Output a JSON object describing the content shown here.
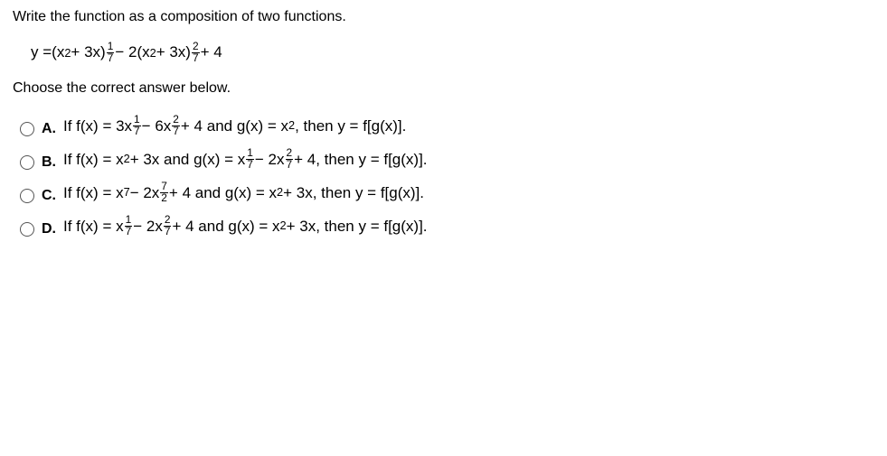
{
  "question_text": "Write the function as a composition of two functions.",
  "instruction": "Choose the correct answer below.",
  "equation": {
    "lhs": "y = ",
    "part1_base": "(x",
    "part1_sup": "2",
    "part1_cont": " + 3x)",
    "frac1_num": "1",
    "frac1_den": "7",
    "minus2": " − 2",
    "part2_base": "(x",
    "part2_sup": "2",
    "part2_cont": " + 3x)",
    "frac2_num": "2",
    "frac2_den": "7",
    "plus4": " + 4"
  },
  "choices": {
    "A": {
      "label": "A.",
      "p": {
        "t1": "If f(x) = 3x",
        "f1n": "1",
        "f1d": "7",
        "t2": " − 6x",
        "f2n": "2",
        "f2d": "7",
        "t3": " + 4 and g(x) = x",
        "s1": "2",
        "t4": ", then y = f[g(x)]."
      }
    },
    "B": {
      "label": "B.",
      "p": {
        "t1": "If f(x) = x",
        "s1": "2",
        "t2": " + 3x and g(x) = x",
        "f1n": "1",
        "f1d": "7",
        "t3": " − 2x",
        "f2n": "2",
        "f2d": "7",
        "t4": " + 4, then y = f[g(x)]."
      }
    },
    "C": {
      "label": "C.",
      "p": {
        "t1": "If f(x) = x",
        "s1": "7",
        "t2": " − 2x",
        "f1n": "7",
        "f1d": "2",
        "t3": " + 4 and g(x) = x",
        "s2": "2",
        "t4": " + 3x, then y = f[g(x)]."
      }
    },
    "D": {
      "label": "D.",
      "p": {
        "t1": "If f(x) = x",
        "f1n": "1",
        "f1d": "7",
        "t2": " − 2x",
        "f2n": "2",
        "f2d": "7",
        "t3": " + 4 and g(x) = x",
        "s1": "2",
        "t4": " + 3x, then y = f[g(x)]."
      }
    }
  }
}
